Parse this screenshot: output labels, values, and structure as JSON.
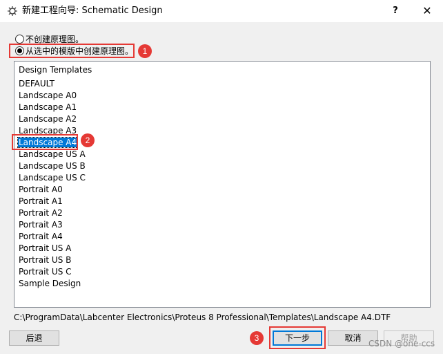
{
  "window": {
    "title": "新建工程向导: Schematic Design",
    "help_label": "?",
    "close_label": "✕"
  },
  "options": {
    "no_schematic": "不创建原理图。",
    "from_template": "从选中的模版中创建原理图。",
    "selected": "from_template"
  },
  "list": {
    "header": "Design Templates",
    "items": [
      "DEFAULT",
      "Landscape A0",
      "Landscape A1",
      "Landscape A2",
      "Landscape A3",
      "Landscape A4",
      "Landscape US A",
      "Landscape US B",
      "Landscape US C",
      "Portrait A0",
      "Portrait A1",
      "Portrait A2",
      "Portrait A3",
      "Portrait A4",
      "Portrait US A",
      "Portrait US B",
      "Portrait US C",
      "Sample Design"
    ],
    "selected": "Landscape A4"
  },
  "path": "C:\\ProgramData\\Labcenter Electronics\\Proteus 8 Professional\\Templates\\Landscape A4.DTF",
  "buttons": {
    "back": "后退",
    "next": "下一步",
    "cancel": "取消",
    "help": "帮助"
  },
  "annotations": [
    "1",
    "2",
    "3"
  ],
  "watermark": "CSDN @one-ccs",
  "colors": {
    "annotation": "#e53935",
    "selection": "#0078d7"
  }
}
